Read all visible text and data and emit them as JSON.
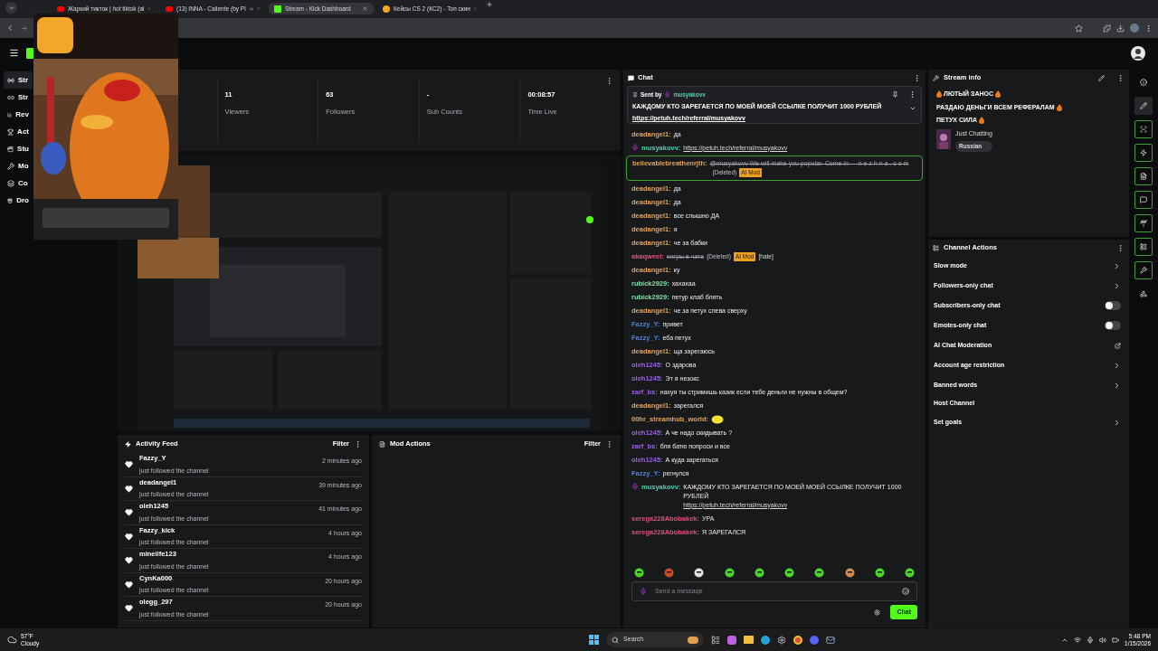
{
  "browser": {
    "tabs": [
      {
        "label": "Жаркий тикток | hot tiktok (al",
        "kind": "youtube",
        "playing": false,
        "selected": false
      },
      {
        "label": "(13) INNA - Caliente (by Pl",
        "kind": "youtube",
        "playing": true,
        "selected": false
      },
      {
        "label": "Stream - Kick Dashboard",
        "kind": "kick",
        "playing": false,
        "selected": true
      },
      {
        "label": "Кейсы CS 2 (КС2) - Топ скин",
        "kind": "cs",
        "playing": false,
        "selected": false
      }
    ]
  },
  "sidebar": {
    "items": [
      {
        "label": "Str",
        "selected": true
      },
      {
        "label": "Str",
        "selected": false
      },
      {
        "label": "Rev",
        "selected": false
      },
      {
        "label": "Act",
        "selected": false
      },
      {
        "label": "Stu",
        "selected": false
      },
      {
        "label": "Mo",
        "selected": false
      },
      {
        "label": "Co",
        "selected": false
      },
      {
        "label": "Dro",
        "selected": false
      }
    ]
  },
  "stats": [
    {
      "value": "11",
      "label": "Viewers"
    },
    {
      "value": "63",
      "label": "Followers"
    },
    {
      "value": "-",
      "label": "Sub Counts"
    },
    {
      "value": "00:08:57",
      "label": "Time Live"
    }
  ],
  "activity_feed": {
    "title": "Activity Feed",
    "filter": "Filter",
    "items": [
      {
        "name": "Fazzy_Y",
        "action": "just followed the channel",
        "time": "2 minutes ago"
      },
      {
        "name": "deadangel1",
        "action": "just followed the channel",
        "time": "39 minutes ago"
      },
      {
        "name": "oleh1245",
        "action": "just followed the channel",
        "time": "41 minutes ago"
      },
      {
        "name": "Fazzy_kick",
        "action": "just followed the channel",
        "time": "4 hours ago"
      },
      {
        "name": "minelife123",
        "action": "just followed the channel",
        "time": "4 hours ago"
      },
      {
        "name": "CynKa000",
        "action": "just followed the channel",
        "time": "20 hours ago"
      },
      {
        "name": "olegg_297",
        "action": "just followed the channel",
        "time": "20 hours ago"
      }
    ]
  },
  "mod_actions": {
    "title": "Mod Actions",
    "filter": "Filter"
  },
  "chat": {
    "title": "Chat",
    "pinned": {
      "sent_by": "Sent by",
      "user": "musyakovv",
      "text": "КАЖДОМУ КТО ЗАРЕГАЕТСЯ ПО МОЕЙ МОЕЙ ССЫЛКЕ ПОЛУЧИТ 1000 РУБЛЕЙ",
      "link": "https://petuh.tech/referral/musyakovv"
    },
    "messages": [
      {
        "kind": "text",
        "user": "deadangel1:",
        "color": "#e3a35c",
        "broadcaster": false,
        "text": "да"
      },
      {
        "kind": "text",
        "user": "musyakovv:",
        "color": "#4fd1b0",
        "broadcaster": true,
        "link": "https://petuh.tech/referral/musyakovv"
      },
      {
        "kind": "flagged",
        "user": "believablebreathenrjth:",
        "color": "#e3a35c",
        "broadcaster": false,
        "text": "@musyakovv We will make you popular. Come in — n e z h n a . c o m",
        "labels": [
          {
            "kind": "note",
            "text": "(Deleted)"
          },
          {
            "kind": "badge",
            "text": "AI Mod"
          }
        ]
      },
      {
        "kind": "text",
        "user": "deadangel1:",
        "color": "#e3a35c",
        "broadcaster": false,
        "text": "да"
      },
      {
        "kind": "text",
        "user": "deadangel1:",
        "color": "#e3a35c",
        "broadcaster": false,
        "text": "да"
      },
      {
        "kind": "text",
        "user": "deadangel1:",
        "color": "#e3a35c",
        "broadcaster": false,
        "text": "все слышно ДА"
      },
      {
        "kind": "text",
        "user": "deadangel1:",
        "color": "#e3a35c",
        "broadcaster": false,
        "text": "я"
      },
      {
        "kind": "text",
        "user": "deadangel1:",
        "color": "#e3a35c",
        "broadcaster": false,
        "text": "че за бабки"
      },
      {
        "kind": "deleted",
        "user": "akaqweel:",
        "color": "#e0507a",
        "broadcaster": false,
        "text": "нигры в чате",
        "labels": [
          {
            "kind": "note",
            "text": "(Deleted)"
          },
          {
            "kind": "badge",
            "text": "AI Mod"
          },
          {
            "kind": "tag",
            "text": "[hate]"
          }
        ]
      },
      {
        "kind": "text",
        "user": "deadangel1:",
        "color": "#e3a35c",
        "broadcaster": false,
        "text": "ку"
      },
      {
        "kind": "text",
        "user": "rubick2929:",
        "color": "#7de3a8",
        "broadcaster": false,
        "text": "хахахаа"
      },
      {
        "kind": "text",
        "user": "rubick2929:",
        "color": "#7de3a8",
        "broadcaster": false,
        "text": "петур клаб блять"
      },
      {
        "kind": "text",
        "user": "deadangel1:",
        "color": "#e3a35c",
        "broadcaster": false,
        "text": "че за петух слева сверху"
      },
      {
        "kind": "text",
        "user": "Fazzy_Y:",
        "color": "#4a82e0",
        "broadcaster": false,
        "text": "привет"
      },
      {
        "kind": "text",
        "user": "Fazzy_Y:",
        "color": "#4a82e0",
        "broadcaster": false,
        "text": "еба петух"
      },
      {
        "kind": "text",
        "user": "deadangel1:",
        "color": "#e3a35c",
        "broadcaster": false,
        "text": "ща зарегаюсь"
      },
      {
        "kind": "text",
        "user": "oleh1245:",
        "color": "#9b62e6",
        "broadcaster": false,
        "text": "О здарова"
      },
      {
        "kind": "text",
        "user": "oleh1245:",
        "color": "#9b62e6",
        "broadcaster": false,
        "text": "Эт я незокс"
      },
      {
        "kind": "text",
        "user": "zarf_bs:",
        "color": "#9b62e6",
        "broadcaster": false,
        "text": "нахуя ты стримишь казик если тебе деньги не нужны в общем?"
      },
      {
        "kind": "text",
        "user": "deadangel1:",
        "color": "#e3a35c",
        "broadcaster": false,
        "text": "зарегался"
      },
      {
        "kind": "emote",
        "user": "00hr_streamhub_world:",
        "color": "#e3a35c",
        "broadcaster": false
      },
      {
        "kind": "text",
        "user": "oleh1245:",
        "color": "#9b62e6",
        "broadcaster": false,
        "text": "А че надо скидывать ?"
      },
      {
        "kind": "text",
        "user": "zarf_bs:",
        "color": "#9b62e6",
        "broadcaster": false,
        "text": "бля батю попроси и все"
      },
      {
        "kind": "text",
        "user": "oleh1245:",
        "color": "#9b62e6",
        "broadcaster": false,
        "text": "А куда зарегаться"
      },
      {
        "kind": "text",
        "user": "Fazzy_Y:",
        "color": "#4a82e0",
        "broadcaster": false,
        "text": "регнулся"
      },
      {
        "kind": "text",
        "user": "musyakovv:",
        "color": "#4fd1b0",
        "broadcaster": true,
        "text": "КАЖДОМУ КТО ЗАРЕГАЕТСЯ ПО МОЕЙ МОЕЙ ССЫЛКЕ ПОЛУЧИТ 1000 РУБЛЕЙ",
        "link": "https://petuh.tech/referral/musyakovv"
      },
      {
        "kind": "text",
        "user": "serega228Abobakek:",
        "color": "#e0507a",
        "broadcaster": false,
        "text": "УРА"
      },
      {
        "kind": "text",
        "user": "serega228Abobakek:",
        "color": "#e0507a",
        "broadcaster": false,
        "text": "Я ЗАРЕГАЛСЯ"
      }
    ],
    "input": {
      "placeholder": "Send a message"
    },
    "send": "Chat"
  },
  "stream_info": {
    "title": "Stream info",
    "title_parts": [
      "ЛЮТЫЙ ЗАНОС",
      "РАЗДАЮ ДЕНЬГИ ВСЕМ РЕФЕРАЛАМ",
      "ПЕТУХ СИЛА"
    ],
    "category": "Just Chatting",
    "tag": "Russian"
  },
  "channel_actions": {
    "title": "Channel Actions",
    "items": [
      {
        "kind": "chevron",
        "label": "Slow mode"
      },
      {
        "kind": "chevron",
        "label": "Followers-only chat"
      },
      {
        "kind": "toggle",
        "label": "Subscribers-only chat",
        "on": false
      },
      {
        "kind": "toggle",
        "label": "Emotes-only chat",
        "on": false
      },
      {
        "kind": "external",
        "label": "AI Chat Moderation"
      },
      {
        "kind": "chevron",
        "label": "Account age restriction"
      },
      {
        "kind": "chevron",
        "label": "Banned words"
      },
      {
        "kind": "plain",
        "label": "Host Channel"
      },
      {
        "kind": "chevron",
        "label": "Set goals"
      }
    ]
  },
  "rail_buttons": [
    {
      "selected": false,
      "enabled": false
    },
    {
      "selected": true,
      "enabled": false
    },
    {
      "selected": false,
      "enabled": true
    },
    {
      "selected": false,
      "enabled": true
    },
    {
      "selected": false,
      "enabled": true
    },
    {
      "selected": false,
      "enabled": true
    },
    {
      "selected": false,
      "enabled": true
    },
    {
      "selected": false,
      "enabled": true
    },
    {
      "selected": false,
      "enabled": true
    },
    {
      "selected": false,
      "enabled": false
    }
  ],
  "taskbar": {
    "temperature": "57°F",
    "weather": "Cloudy",
    "search": "Search",
    "time": "5:48 PM",
    "date": "1/15/2026"
  }
}
